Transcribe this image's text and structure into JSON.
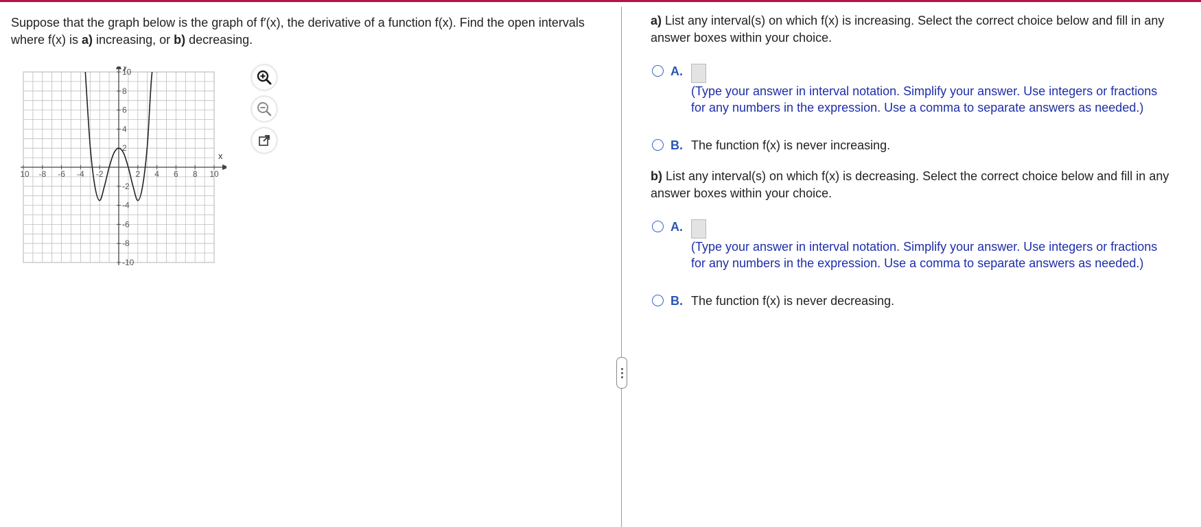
{
  "question": {
    "prefix": "Suppose that the graph below is the graph of f′(x), the derivative of a function f(x). Find the open intervals where f(x) is ",
    "a_label": "a)",
    "middle": " increasing, or ",
    "b_label": "b)",
    "suffix": " decreasing."
  },
  "graph": {
    "y_label": "y",
    "x_label": "x",
    "x_ticks": [
      "-10",
      "-8",
      "-6",
      "-4",
      "-2",
      "2",
      "4",
      "6",
      "8",
      "10"
    ],
    "y_ticks": [
      "10",
      "8",
      "6",
      "4",
      "2",
      "-2",
      "-4",
      "-6",
      "-8",
      "-10"
    ]
  },
  "chart_data": {
    "type": "line",
    "xlim": [
      -10,
      10
    ],
    "ylim": [
      -10,
      10
    ],
    "grid": true,
    "x_tick_values": [
      -10,
      -8,
      -6,
      -4,
      -2,
      2,
      4,
      6,
      8,
      10
    ],
    "y_tick_values": [
      10,
      8,
      6,
      4,
      2,
      -2,
      -4,
      -6,
      -8,
      -10
    ],
    "series": [
      {
        "x": [
          -3.5,
          -3.0,
          -2.5,
          -2.0,
          -1.5,
          -1.0,
          -0.5,
          0.0,
          0.5,
          1.0,
          1.5,
          2.0,
          2.5,
          3.0,
          3.5,
          4.0
        ],
        "y": [
          10,
          2.3,
          -2.0,
          -3.5,
          -2.0,
          0.0,
          1.5,
          2.0,
          1.5,
          0.0,
          -2.0,
          -3.5,
          -2.0,
          2.3,
          10,
          10
        ]
      }
    ]
  },
  "tools": {
    "zoom_in": "zoom-in-icon",
    "zoom_out": "zoom-out-icon",
    "popout": "popout-icon"
  },
  "part_a": {
    "label": "a)",
    "prompt": " List any interval(s) on which f(x) is increasing. Select the correct choice below and fill in any answer boxes within your choice.",
    "choice_a_letter": "A.",
    "choice_a_hint": "(Type your answer in interval notation. Simplify your answer. Use integers or fractions for any numbers in the expression. Use a comma to separate answers as needed.)",
    "choice_b_letter": "B.",
    "choice_b_text": "The function f(x) is never increasing."
  },
  "part_b": {
    "label": "b)",
    "prompt": " List any interval(s) on which f(x) is decreasing. Select the correct choice below and fill in any answer boxes within your choice.",
    "choice_a_letter": "A.",
    "choice_a_hint": "(Type your answer in interval notation. Simplify your answer. Use integers or fractions for any numbers in the expression. Use a comma to separate answers as needed.)",
    "choice_b_letter": "B.",
    "choice_b_text": "The function f(x) is never decreasing."
  },
  "colors": {
    "accent": "#b3144a",
    "choice_letter": "#2a55b8",
    "hint_text": "#1d2ea8"
  }
}
